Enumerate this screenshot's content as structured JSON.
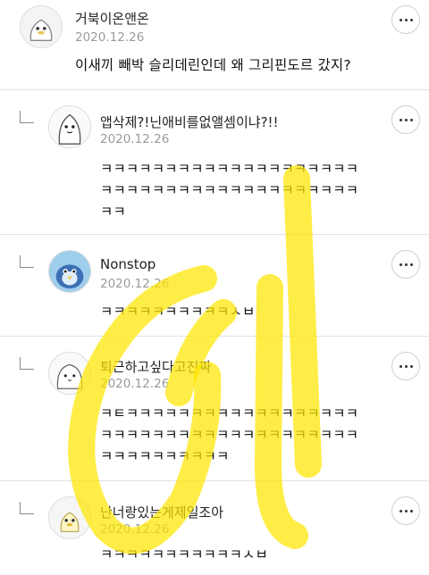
{
  "comments": [
    {
      "nickname": "거북이온앤온",
      "date": "2020.12.26",
      "lines": [
        "이새끼 빼박 슬리데린인데 왜 그리핀도르 갔지?"
      ]
    },
    {
      "nickname": "앱삭제?!닌애비를없앨셈이냐?!!",
      "date": "2020.12.26",
      "lines": [
        "ㅋㅋㅋㅋㅋㅋㅋㅋㅋㅋㅋㅋㅋㅋㅋㅋㅋㅋㅋㅋ",
        "ㅋㅋㅋㅋㅋㅋㅋㅋㅋㅋㅋㅋㅋㅋㅋㅋㅋㅋㅋㅋ",
        "ㅋㅋ"
      ]
    },
    {
      "nickname": "Nonstop",
      "date": "2020.12.26",
      "lines": [
        "ㅋㅋㅋㅋㅋㅋㅋㅋㅋㅋㅅㅂ"
      ]
    },
    {
      "nickname": "퇴근하고싶다고진짜",
      "date": "2020.12.26",
      "lines": [
        "ㅋㅌㅋㅋㅋㅋㅋㅋㅋㅋㅋㅋㅋㅋㅋㅋㅋㅋㅋㅋ",
        "ㅋㅋㅋㅋㅋㅋㅋㅋㅋㅋㅋㅋㅋㅋㅋㅋㅋㅋㅋㅋ",
        "ㅋㅋㅋㅋㅋㅋㅋㅋㅋㅋ"
      ]
    },
    {
      "nickname": "난너랑있는게제일조아",
      "date": "2020.12.26",
      "lines": [
        "ㅋㅋㅋㅋㅋㅋㅋㅋㅋㅋㅋㅅㅂ"
      ]
    }
  ],
  "icons": {
    "more": "more-options-icon",
    "reply": "reply-arrow-icon",
    "avatar": "profile-avatar-icon"
  },
  "colors": {
    "watermark": "#ffe600",
    "date": "#9a9a9a",
    "divider": "#e2e2e2"
  }
}
